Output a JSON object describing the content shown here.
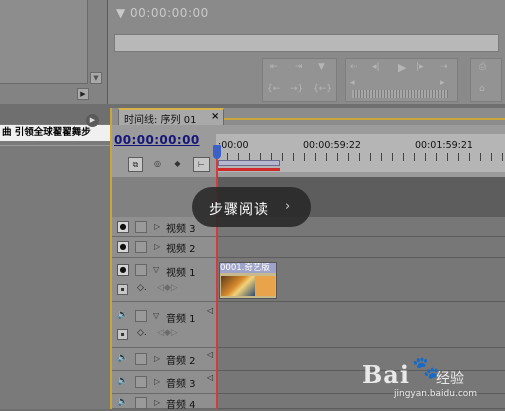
{
  "monitor": {
    "timecode": "00:00:00:00",
    "controls_row1": [
      "⇤",
      "⇥",
      "▼",
      "⇠",
      "◂|",
      "▶",
      "|▸",
      "⇢"
    ],
    "controls_row2": [
      "{←",
      "→}",
      "{←}",
      "◉◉",
      "◂",
      "▸"
    ]
  },
  "left_panel": {
    "media_title": "曲 引领全球翟翟舞步",
    "scroll_down": "▼",
    "scroll_right": "▶",
    "panel_menu": "▶"
  },
  "timeline": {
    "tab_label": "时间线: 序列 01",
    "tab_close": "×",
    "current_time": "00:00:00:00",
    "ruler_labels": [
      ":00:00",
      "00:00:59:22",
      "00:01:59:21"
    ],
    "tracks": [
      {
        "name": "视频 3",
        "kind": "video"
      },
      {
        "name": "视频 2",
        "kind": "video"
      },
      {
        "name": "视频 1",
        "kind": "video",
        "expanded": true
      },
      {
        "name": "音频 1",
        "kind": "audio",
        "expanded": true
      },
      {
        "name": "音频 2",
        "kind": "audio"
      },
      {
        "name": "音频 3",
        "kind": "audio"
      },
      {
        "name": "音频 4",
        "kind": "audio"
      }
    ],
    "clip_label": "0001.奇艺版"
  },
  "overlay": {
    "step_reading": "步骤阅读",
    "arrow": "›"
  },
  "watermark": {
    "logo": "Bai",
    "paw": "🐾",
    "brand": "经验",
    "url": "jingyan.baidu.com"
  },
  "colors": {
    "accent_gold": "#c9a53a",
    "playhead_red": "#d13c3c",
    "timecode_blue": "#15157a"
  }
}
